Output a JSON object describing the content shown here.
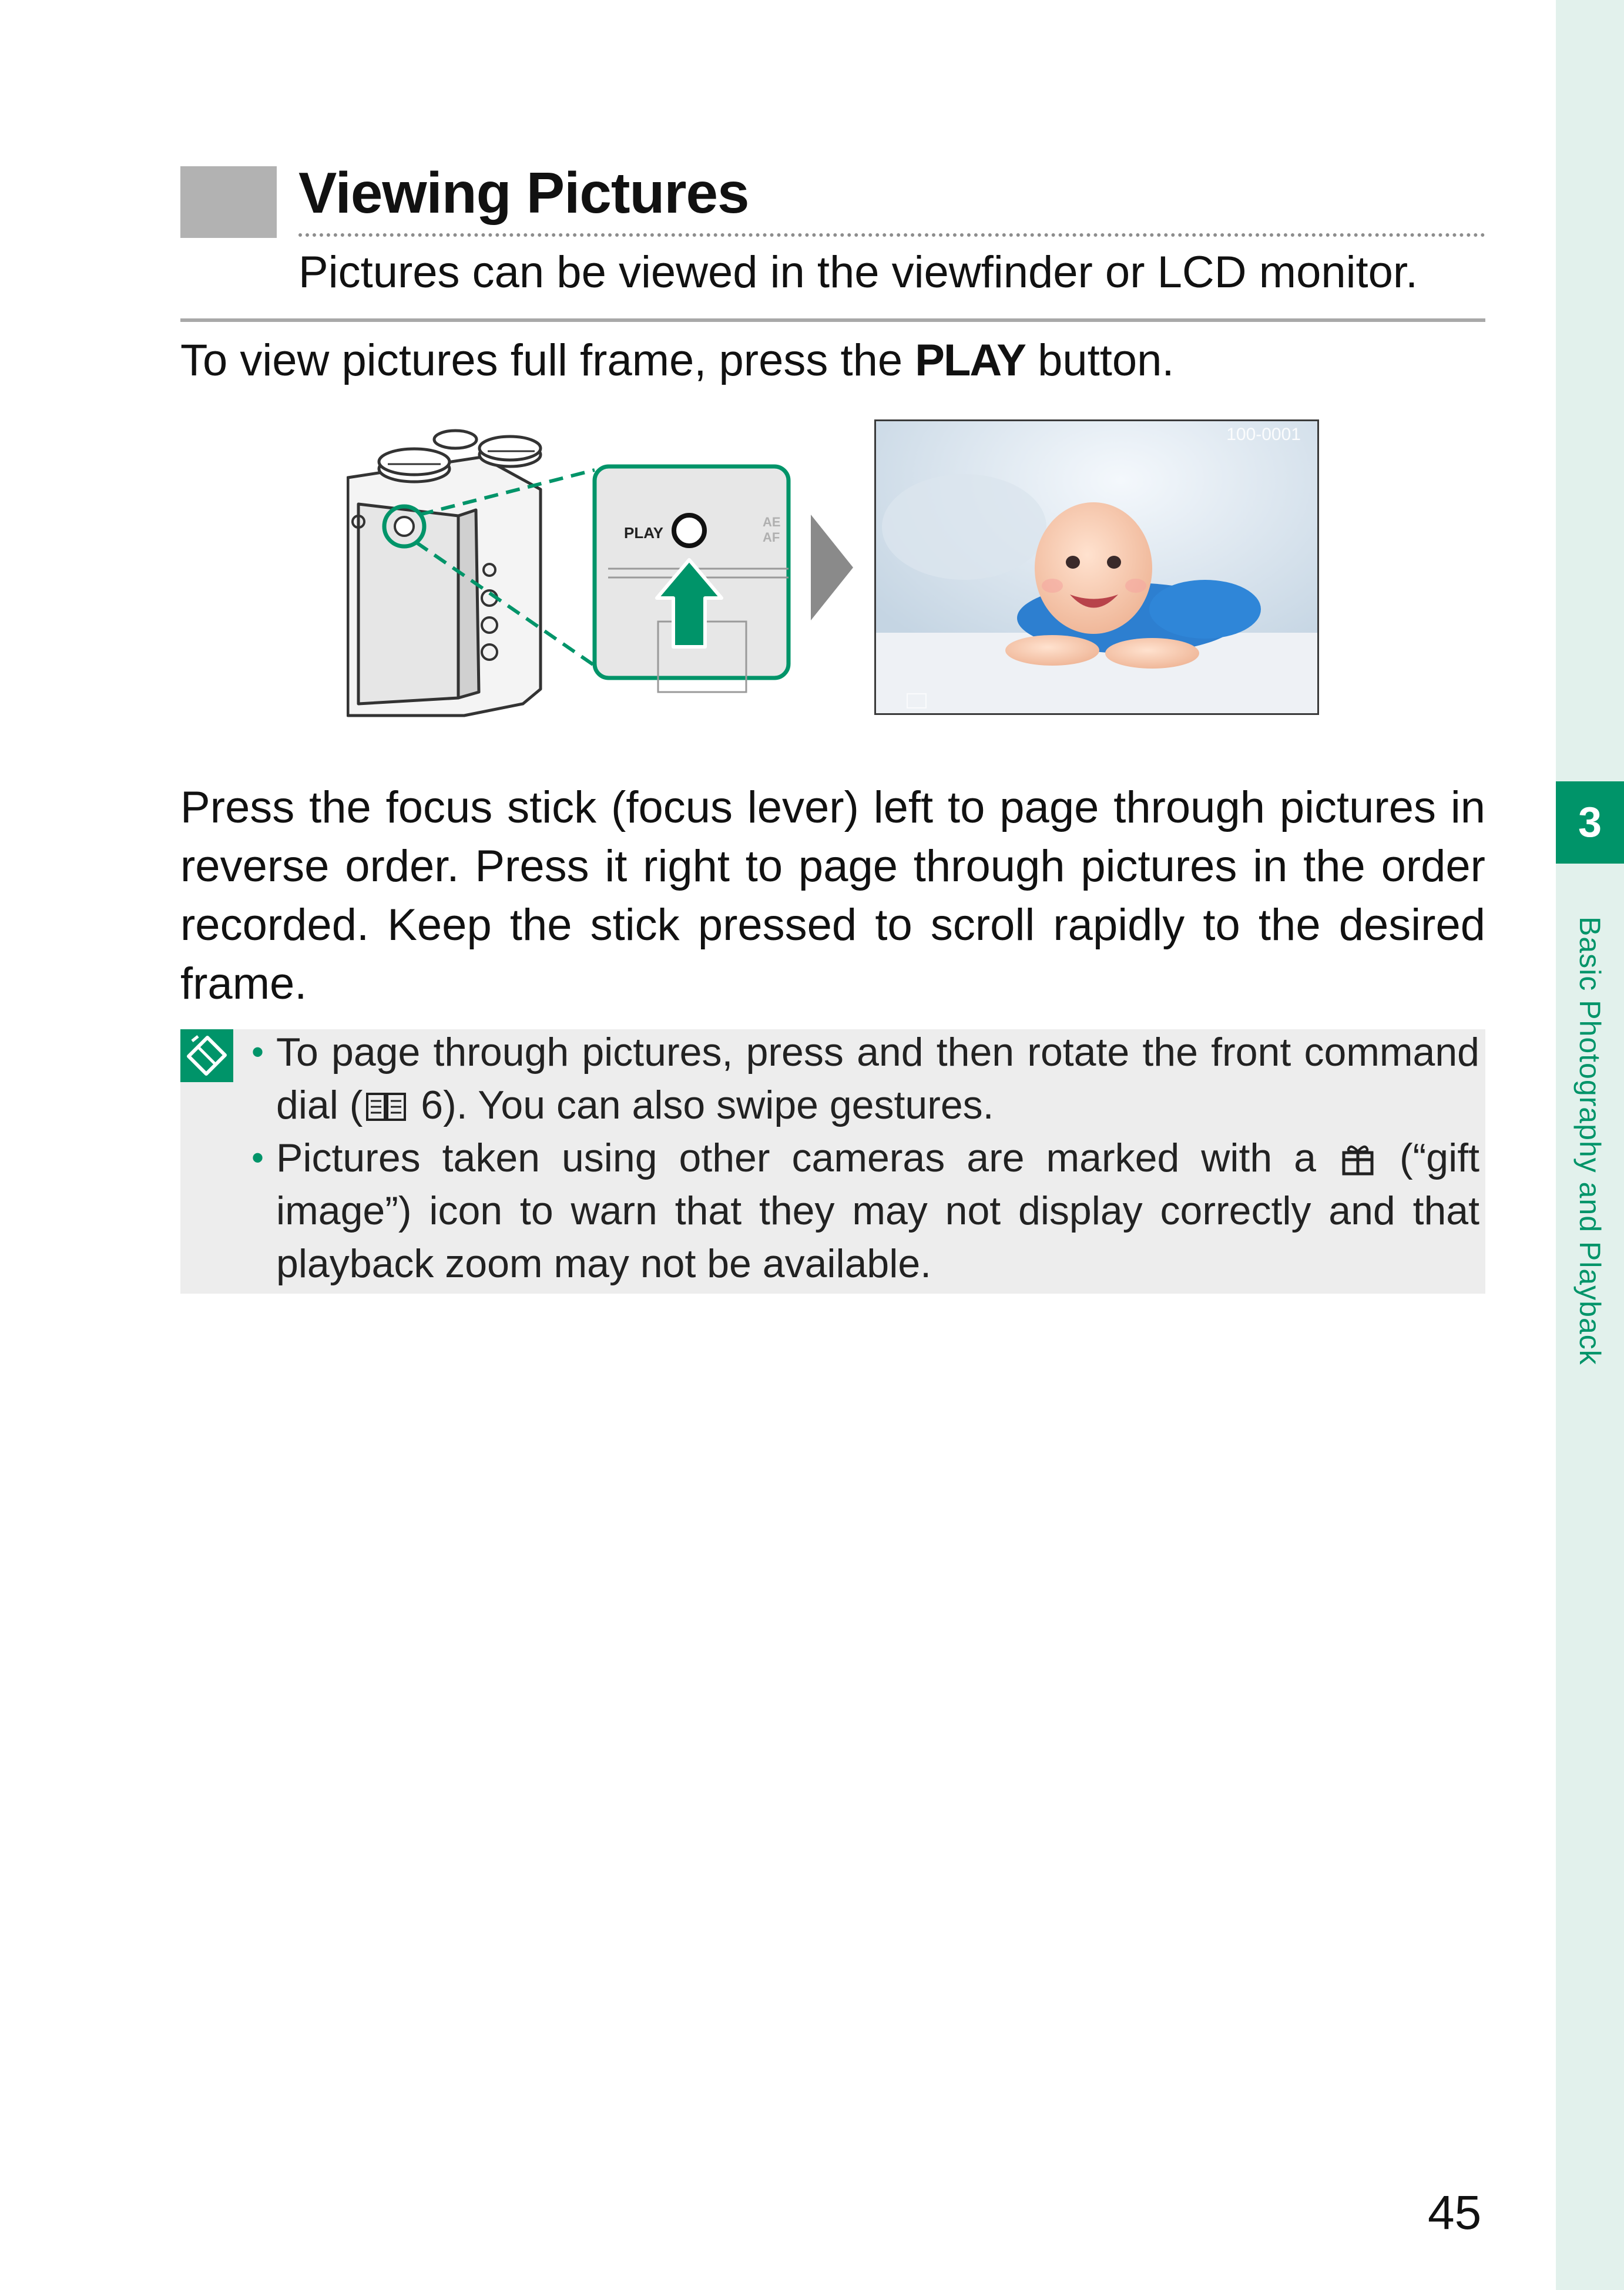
{
  "chapter": {
    "number": "3",
    "title": "Basic Photography and Playback",
    "accent_color": "#009469"
  },
  "header": {
    "title": "Viewing Pictures",
    "subtitle": "Pictures can be viewed in the viewfinder or LCD monitor."
  },
  "intro": {
    "prefix": "To view pictures full frame, press the ",
    "button_name": "PLAY",
    "suffix": " button."
  },
  "illustration": {
    "button_label": "PLAY",
    "adjacent_label_1": "AE",
    "adjacent_label_2": "AF",
    "frame_number": "100-0001",
    "icons": [
      "camera-illustration",
      "play-button-icon",
      "up-arrow-icon",
      "right-triangle-arrow-icon",
      "baby-photo-preview"
    ]
  },
  "paragraph": "Press the focus stick (focus lever) left to page through pictures in reverse order. Press it right to page through pictures in the order recorded. Keep the stick pressed to scroll rapidly to the desired frame.",
  "notes": {
    "icon": "note-pencil-icon",
    "items": [
      {
        "before": "To page through pictures, press and then rotate the front command dial (",
        "icon": "book-reference-icon",
        "after": " 6). You can also swipe gestures."
      },
      {
        "before": "Pictures taken using other cameras are marked with a ",
        "icon": "gift-image-icon",
        "after": " (“gift image”) icon to warn that they may not display correctly and that playback zoom may not be available."
      }
    ]
  },
  "page_number": "45"
}
